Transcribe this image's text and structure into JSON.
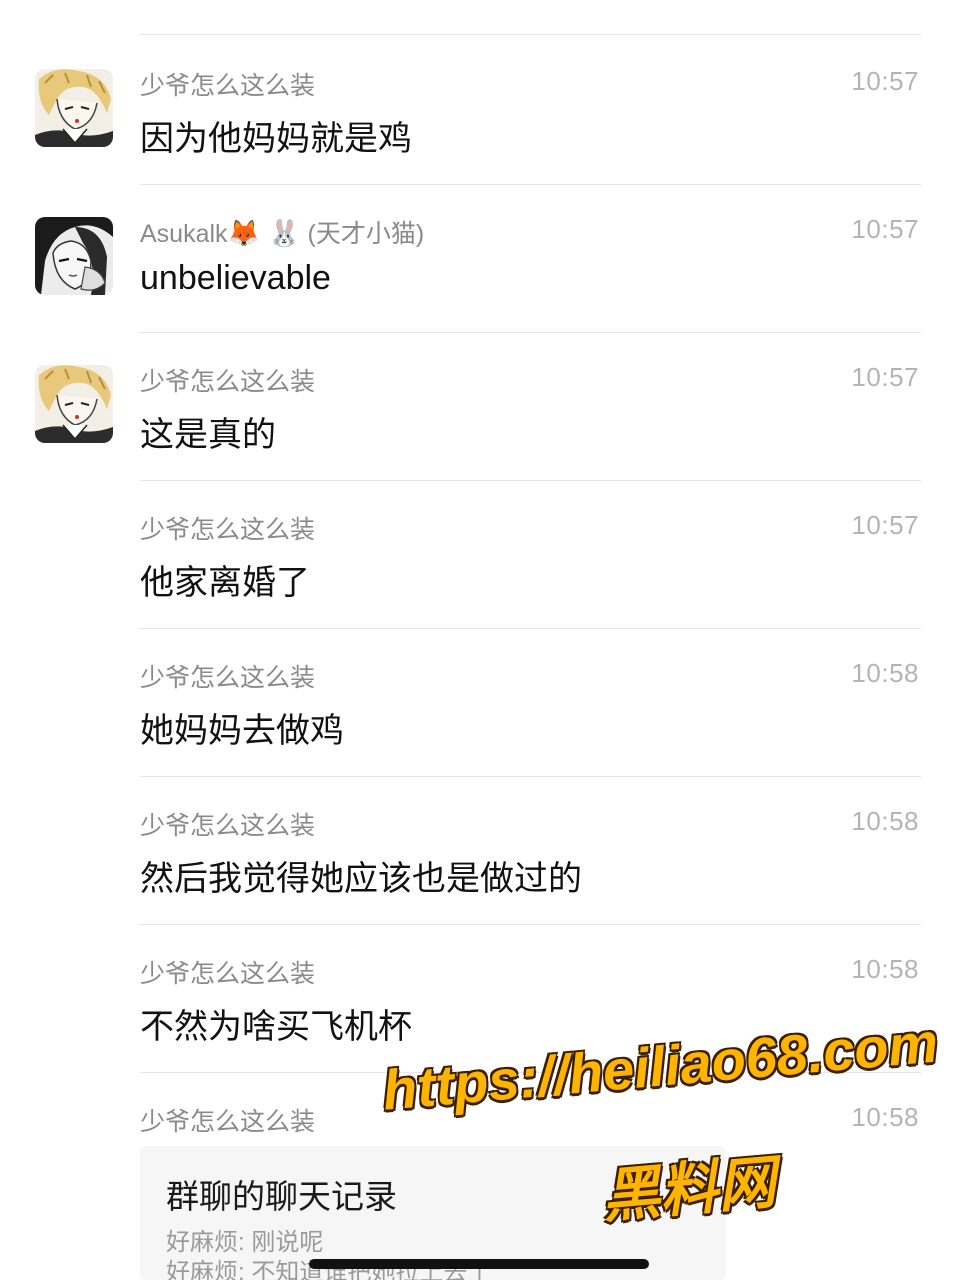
{
  "messages": [
    {
      "sender": "少爷怎么这么装",
      "time": "10:57",
      "text": "因为他妈妈就是鸡",
      "avatar": "anime-blond-avatar"
    },
    {
      "sender_name": "Asukalk",
      "sender_emoji": "🦊 🐰",
      "sender_suffix": "(天才小猫)",
      "time": "10:57",
      "text": "unbelievable",
      "avatar": "anime-dark-hair-avatar"
    },
    {
      "sender": "少爷怎么这么装",
      "time": "10:57",
      "text": "这是真的",
      "avatar": "anime-blond-avatar"
    },
    {
      "sender": "少爷怎么这么装",
      "time": "10:57",
      "text": "他家离婚了"
    },
    {
      "sender": "少爷怎么这么装",
      "time": "10:58",
      "text": "她妈妈去做鸡"
    },
    {
      "sender": "少爷怎么这么装",
      "time": "10:58",
      "text": "然后我觉得她应该也是做过的"
    },
    {
      "sender": "少爷怎么这么装",
      "time": "10:58",
      "text": "不然为啥买飞机杯"
    },
    {
      "sender": "少爷怎么这么装",
      "time": "10:58"
    }
  ],
  "forwarded_card": {
    "title": "群聊的聊天记录",
    "lines": [
      "好麻烦: 刚说呢",
      "好麻烦: 不知道谁把她拉上去了"
    ]
  },
  "watermark": {
    "url": "https://heiliao68.com",
    "name": "黑料网",
    "color": "#ffb400"
  }
}
